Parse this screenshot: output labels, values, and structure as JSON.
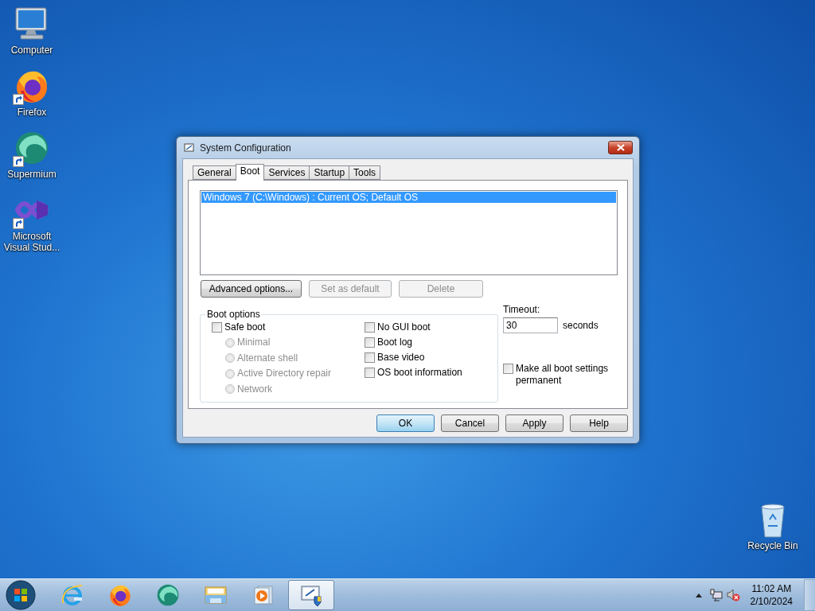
{
  "desktop_icons": [
    {
      "label": "Computer",
      "kind": "computer",
      "shortcut": false
    },
    {
      "label": "Firefox",
      "kind": "firefox",
      "shortcut": true
    },
    {
      "label": "Supermium",
      "kind": "supermium",
      "shortcut": true
    },
    {
      "label": "Microsoft Visual Stud...",
      "kind": "visualstudio",
      "shortcut": true
    }
  ],
  "recycle_bin": {
    "label": "Recycle Bin"
  },
  "dialog": {
    "title": "System Configuration",
    "tabs": [
      {
        "label": "General",
        "selected": false
      },
      {
        "label": "Boot",
        "selected": true
      },
      {
        "label": "Services",
        "selected": false
      },
      {
        "label": "Startup",
        "selected": false
      },
      {
        "label": "Tools",
        "selected": false
      }
    ],
    "boot_entries": [
      {
        "label": "Windows 7 (C:\\Windows) : Current OS; Default OS",
        "selected": true
      }
    ],
    "entry_buttons": [
      {
        "label": "Advanced options...",
        "disabled": false
      },
      {
        "label": "Set as default",
        "disabled": true
      },
      {
        "label": "Delete",
        "disabled": true
      }
    ],
    "boot_options": {
      "title": "Boot options",
      "safe_boot": {
        "label": "Safe boot",
        "checked": false
      },
      "safe_modes": [
        {
          "label": "Minimal",
          "selected": false,
          "disabled": true
        },
        {
          "label": "Alternate shell",
          "selected": false,
          "disabled": true
        },
        {
          "label": "Active Directory repair",
          "selected": false,
          "disabled": true
        },
        {
          "label": "Network",
          "selected": false,
          "disabled": true
        }
      ],
      "flags": [
        {
          "label": "No GUI boot",
          "checked": false
        },
        {
          "label": "Boot log",
          "checked": false
        },
        {
          "label": "Base video",
          "checked": false
        },
        {
          "label": "OS boot information",
          "checked": false
        }
      ]
    },
    "timeout": {
      "label": "Timeout:",
      "value": "30",
      "unit": "seconds"
    },
    "make_permanent": {
      "label": "Make all boot settings permanent",
      "checked": false
    },
    "buttons": [
      {
        "label": "OK",
        "default": true
      },
      {
        "label": "Cancel",
        "default": false
      },
      {
        "label": "Apply",
        "default": false
      },
      {
        "label": "Help",
        "default": false
      }
    ]
  },
  "taskbar": {
    "items": [
      {
        "kind": "ie",
        "active": false
      },
      {
        "kind": "firefox",
        "active": false
      },
      {
        "kind": "supermium",
        "active": false
      },
      {
        "kind": "explorer",
        "active": false
      },
      {
        "kind": "media",
        "active": false
      },
      {
        "kind": "msconfig",
        "active": true
      }
    ],
    "clock": {
      "time": "11:02 AM",
      "date": "2/10/2024"
    }
  }
}
